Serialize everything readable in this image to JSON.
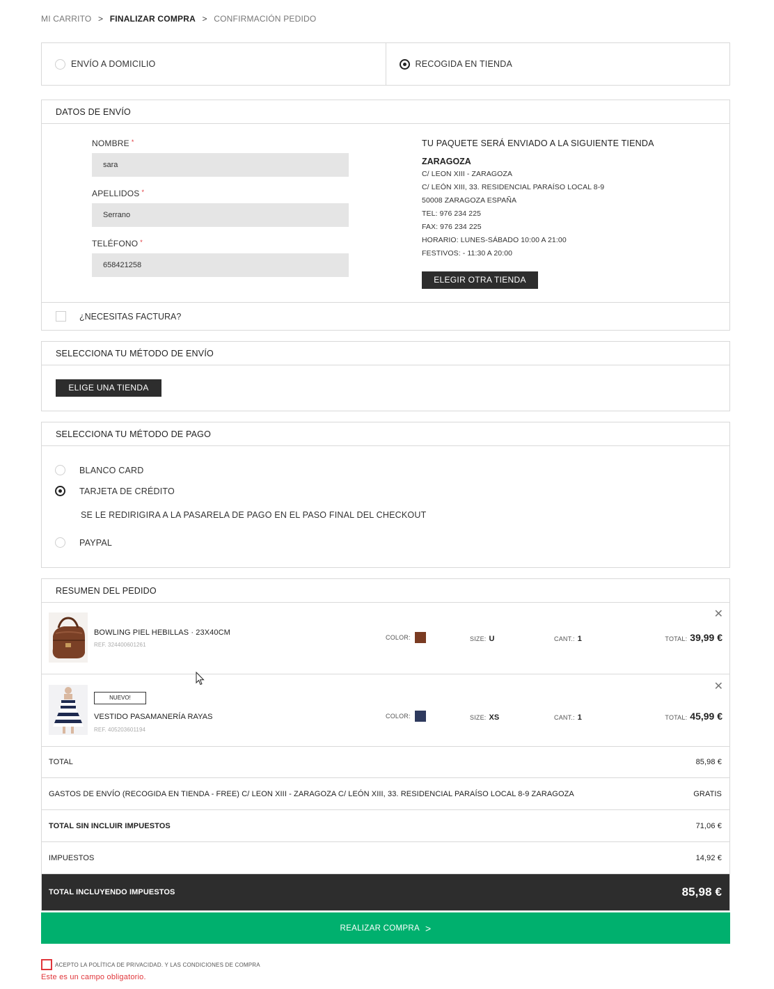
{
  "breadcrumb": {
    "step1": "MI CARRITO",
    "step2": "FINALIZAR COMPRA",
    "step3": "CONFIRMACIÓN PEDIDO",
    "separator": ">"
  },
  "delivery": {
    "home_label": "ENVÍO A DOMICILIO",
    "store_label": "RECOGIDA EN TIENDA",
    "selected": "store"
  },
  "shipping_data": {
    "header": "DATOS DE ENVÍO",
    "name_label": "NOMBRE",
    "name_value": "sara",
    "surname_label": "APELLIDOS",
    "surname_value": "Serrano",
    "phone_label": "TELÉFONO",
    "phone_value": "658421258",
    "required_mark": "*",
    "store_title": "TU PAQUETE SERÁ ENVIADO A LA SIGUIENTE TIENDA",
    "store_name": "ZARAGOZA",
    "store_lines": [
      "C/ LEON XIII - ZARAGOZA",
      "C/ LEÓN XIII, 33. RESIDENCIAL PARAÍSO LOCAL 8-9",
      "50008 ZARAGOZA ESPAÑA",
      "TEL: 976 234 225",
      "FAX: 976 234 225",
      "HORARIO: LUNES-SÁBADO 10:00 A 21:00",
      "FESTIVOS: - 11:30 A 20:00"
    ],
    "choose_store_button": "ELEGIR OTRA TIENDA",
    "invoice_label": "¿NECESITAS FACTURA?"
  },
  "shipping_method": {
    "header": "SELECCIONA TU MÉTODO DE ENVÍO",
    "button": "ELIGE UNA TIENDA"
  },
  "payment": {
    "header": "SELECCIONA TU MÉTODO DE PAGO",
    "options": [
      "BLANCO CARD",
      "TARJETA DE CRÉDITO",
      "PAYPAL"
    ],
    "selected": "TARJETA DE CRÉDITO",
    "note": "SE LE REDIRIGIRA A LA PASARELA DE PAGO EN EL PASO FINAL DEL CHECKOUT"
  },
  "summary": {
    "header": "RESUMEN DEL PEDIDO",
    "color_label": "COLOR:",
    "size_label": "SIZE:",
    "qty_label": "CANT.:",
    "total_label": "TOTAL:",
    "items": [
      {
        "name": "BOWLING PIEL HEBILLAS · 23X40CM",
        "ref": "REF. 324400601261",
        "color": "#7a3b22",
        "size": "U",
        "qty": "1",
        "total": "39,99 €",
        "badge": ""
      },
      {
        "name": "VESTIDO PASAMANERÍA RAYAS",
        "ref": "REF. 405203601194",
        "color": "#2e3a5e",
        "size": "XS",
        "qty": "1",
        "total": "45,99 €",
        "badge": "NUEVO!"
      }
    ],
    "rows": {
      "total_label": "TOTAL",
      "total_value": "85,98 €",
      "shipping_label": "GASTOS DE ENVÍO (RECOGIDA EN TIENDA - FREE) C/ LEON XIII - ZARAGOZA C/ LEÓN XIII, 33. RESIDENCIAL PARAÍSO LOCAL 8-9 ZARAGOZA",
      "shipping_value": "GRATIS",
      "untaxed_label": "TOTAL SIN INCLUIR IMPUESTOS",
      "untaxed_value": "71,06 €",
      "tax_label": "IMPUESTOS",
      "tax_value": "14,92 €",
      "grand_label": "TOTAL INCLUYENDO IMPUESTOS",
      "grand_value": "85,98 €"
    }
  },
  "buy_button": "REALIZAR COMPRA",
  "terms": {
    "label": "ACEPTO LA POLÍTICA DE PRIVACIDAD. Y LAS CONDICIONES DE COMPRA",
    "error": "Este es un campo obligatorio."
  },
  "colors": {
    "accent_green": "#00b06e",
    "dark": "#2d2d2d",
    "error_red": "#e0363b"
  }
}
